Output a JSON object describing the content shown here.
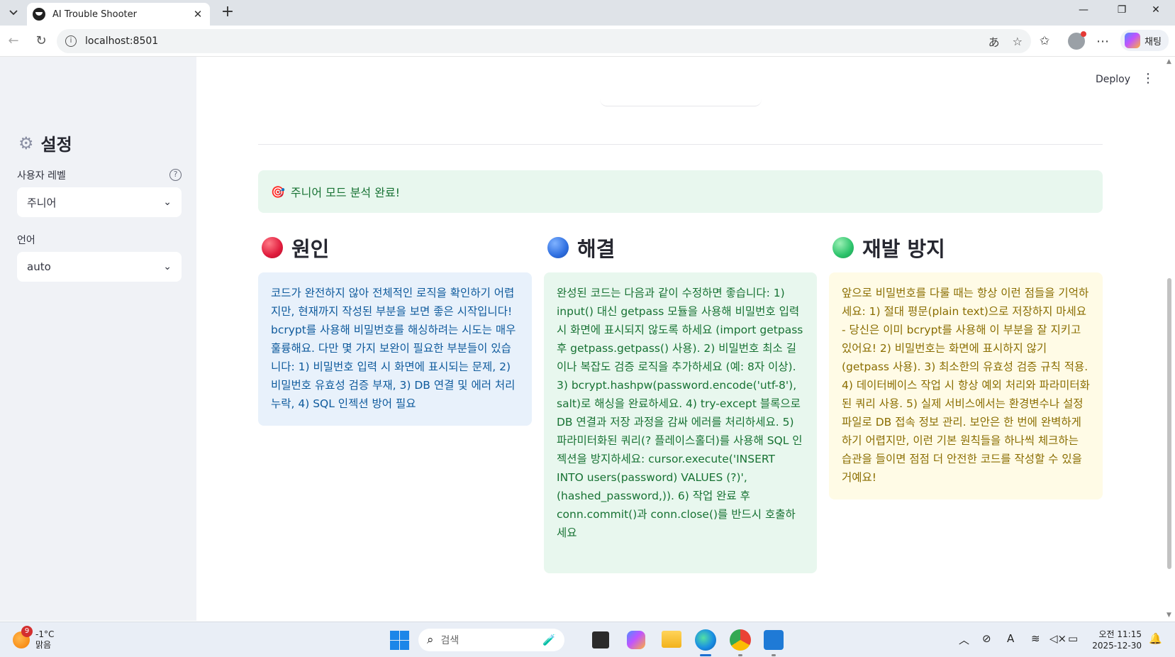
{
  "browser": {
    "tab_title": "AI Trouble Shooter",
    "url": "localhost:8501",
    "copilot_label": "채팅"
  },
  "app": {
    "deploy_label": "Deploy",
    "more_icon": "⋮"
  },
  "sidebar": {
    "title": "설정",
    "level_label": "사용자 레벨",
    "level_value": "주니어",
    "language_label": "언어",
    "language_value": "auto"
  },
  "main": {
    "success_message": "주니어 모드 분석 완료!",
    "columns": [
      {
        "heading": "원인",
        "color": "#e01b3c",
        "body": "코드가 완전하지 않아 전체적인 로직을 확인하기 어렵지만, 현재까지 작성된 부분을 보면 좋은 시작입니다! bcrypt를 사용해 비밀번호를 해싱하려는 시도는 매우 훌륭해요. 다만 몇 가지 보완이 필요한 부분들이 있습니다: 1) 비밀번호 입력 시 화면에 표시되는 문제, 2) 비밀번호 유효성 검증 부재, 3) DB 연결 및 에러 처리 누락, 4) SQL 인젝션 방어 필요"
      },
      {
        "heading": "해결",
        "color": "#2f6fe0",
        "body": "완성된 코드는 다음과 같이 수정하면 좋습니다: 1) input() 대신 getpass 모듈을 사용해 비밀번호 입력 시 화면에 표시되지 않도록 하세요 (import getpass 후 getpass.getpass() 사용). 2) 비밀번호 최소 길이나 복잡도 검증 로직을 추가하세요 (예: 8자 이상). 3) bcrypt.hashpw(password.encode('utf-8'), salt)로 해싱을 완료하세요. 4) try-except 블록으로 DB 연결과 저장 과정을 감싸 에러를 처리하세요. 5) 파라미터화된 쿼리(? 플레이스홀더)를 사용해 SQL 인젝션을 방지하세요: cursor.execute('INSERT INTO users(password) VALUES (?)', (hashed_password,)). 6) 작업 완료 후 conn.commit()과 conn.close()를 반드시 호출하세요"
      },
      {
        "heading": "재발 방지",
        "color": "#2cc36b",
        "body": "앞으로 비밀번호를 다룰 때는 항상 이런 점들을 기억하세요: 1) 절대 평문(plain text)으로 저장하지 마세요 - 당신은 이미 bcrypt를 사용해 이 부분을 잘 지키고 있어요! 2) 비밀번호는 화면에 표시하지 않기 (getpass 사용). 3) 최소한의 유효성 검증 규칙 적용. 4) 데이터베이스 작업 시 항상 예외 처리와 파라미터화된 쿼리 사용. 5) 실제 서비스에서는 환경변수나 설정 파일로 DB 접속 정보 관리. 보안은 한 번에 완벽하게 하기 어렵지만, 이런 기본 원칙들을 하나씩 체크하는 습관을 들이면 점점 더 안전한 코드를 작성할 수 있을 거예요!"
      }
    ]
  },
  "taskbar": {
    "weather_badge": "9",
    "temperature": "-1°C",
    "condition": "맑음",
    "search_placeholder": "검색",
    "time": "오전 11:15",
    "date": "2025-12-30"
  }
}
